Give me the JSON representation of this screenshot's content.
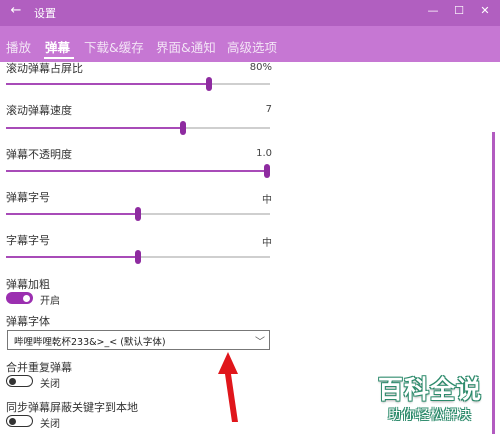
{
  "window": {
    "title": "设置",
    "back_icon": "arrow-left-icon",
    "minimize_glyph": "—",
    "maximize_glyph": "☐",
    "close_glyph": "✕"
  },
  "tabs": [
    {
      "label": "播放",
      "active": false
    },
    {
      "label": "弹幕",
      "active": true
    },
    {
      "label": "下载&缓存",
      "active": false
    },
    {
      "label": "界面&通知",
      "active": false
    },
    {
      "label": "高级选项",
      "active": false
    }
  ],
  "sliders": [
    {
      "label": "滚动弹幕占屏比",
      "value_text": "80%",
      "fraction": 0.77
    },
    {
      "label": "滚动弹幕速度",
      "value_text": "7",
      "fraction": 0.67
    },
    {
      "label": "弹幕不透明度",
      "value_text": "1.0",
      "fraction": 1.0
    },
    {
      "label": "弹幕字号",
      "value_text": "中",
      "fraction": 0.5
    },
    {
      "label": "字幕字号",
      "value_text": "中",
      "fraction": 0.5
    }
  ],
  "bold": {
    "label": "弹幕加粗",
    "state_text": "开启",
    "on": true
  },
  "font": {
    "label": "弹幕字体",
    "selected": "哔哩哔哩乾杯233&>_< (默认字体)",
    "chevron": "﹀"
  },
  "merge": {
    "label": "合并重复弹幕",
    "state_text": "关闭",
    "on": false
  },
  "sync": {
    "label": "同步弹幕屏蔽关键字到本地",
    "state_text": "关闭",
    "on": false
  },
  "watermark": {
    "main": "百科全说",
    "sub": "助你轻松解决"
  },
  "colors": {
    "titlebar": "#b15fc0",
    "tabbar": "#c677d3",
    "accent": "#9b2fb0",
    "arrow": "#e0161b"
  }
}
